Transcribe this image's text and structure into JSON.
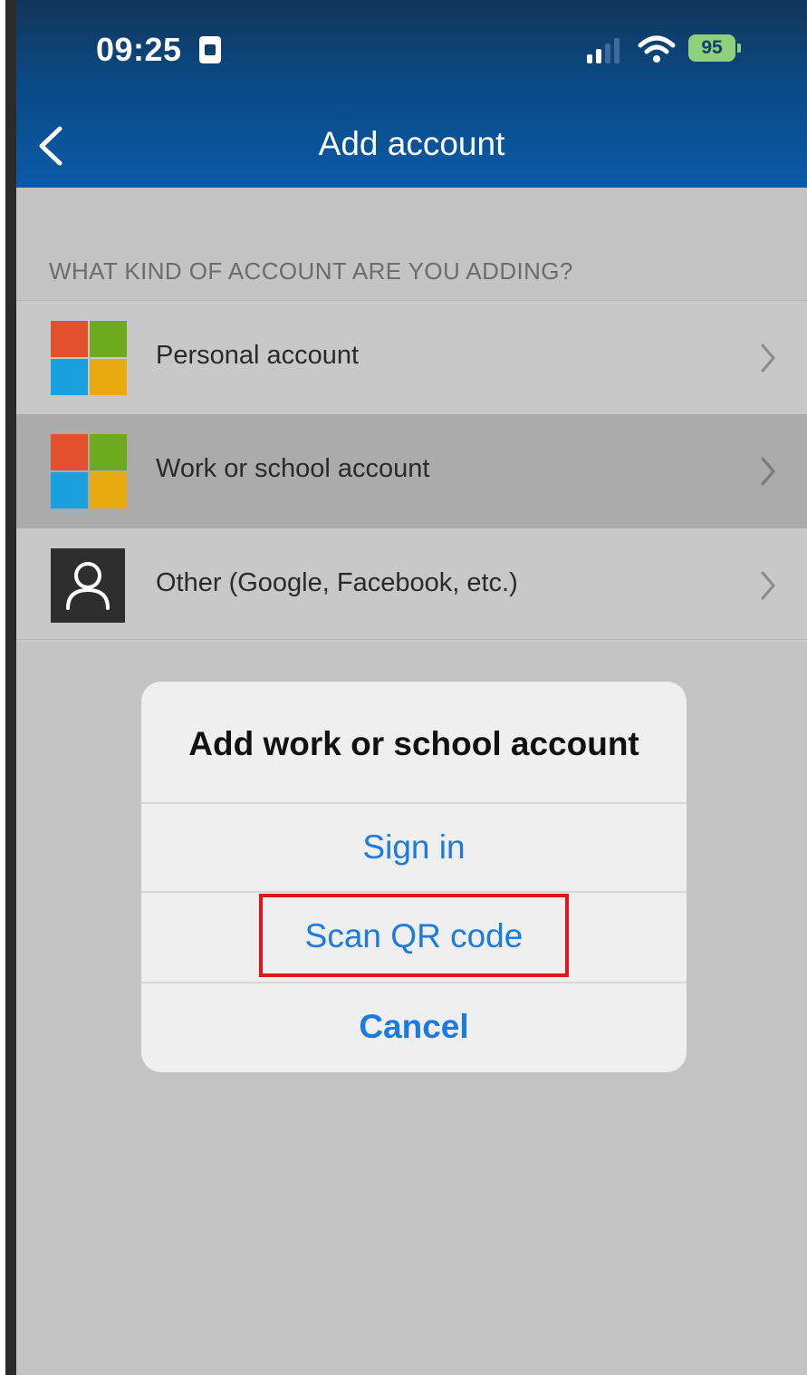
{
  "status_bar": {
    "time": "09:25",
    "battery": "95"
  },
  "nav": {
    "title": "Add account"
  },
  "section": {
    "header": "WHAT KIND OF ACCOUNT ARE YOU ADDING?"
  },
  "accounts": [
    {
      "label": "Personal account",
      "icon": "microsoft-logo-icon"
    },
    {
      "label": "Work or school account",
      "icon": "microsoft-logo-icon",
      "highlighted": true
    },
    {
      "label": "Other (Google, Facebook, etc.)",
      "icon": "person-icon"
    }
  ],
  "dialog": {
    "title": "Add work or school account",
    "buttons": {
      "sign_in": "Sign in",
      "scan_qr": "Scan QR code",
      "cancel": "Cancel"
    },
    "annotation_color": "#e0161c"
  },
  "colors": {
    "header_top": "#12365a",
    "header_bottom": "#0a5aa6",
    "link_blue": "#1b7be0",
    "ms_red": "#e2502d",
    "ms_green": "#6eaa1e",
    "ms_blue": "#1ba0df",
    "ms_yellow": "#e8aa10"
  }
}
